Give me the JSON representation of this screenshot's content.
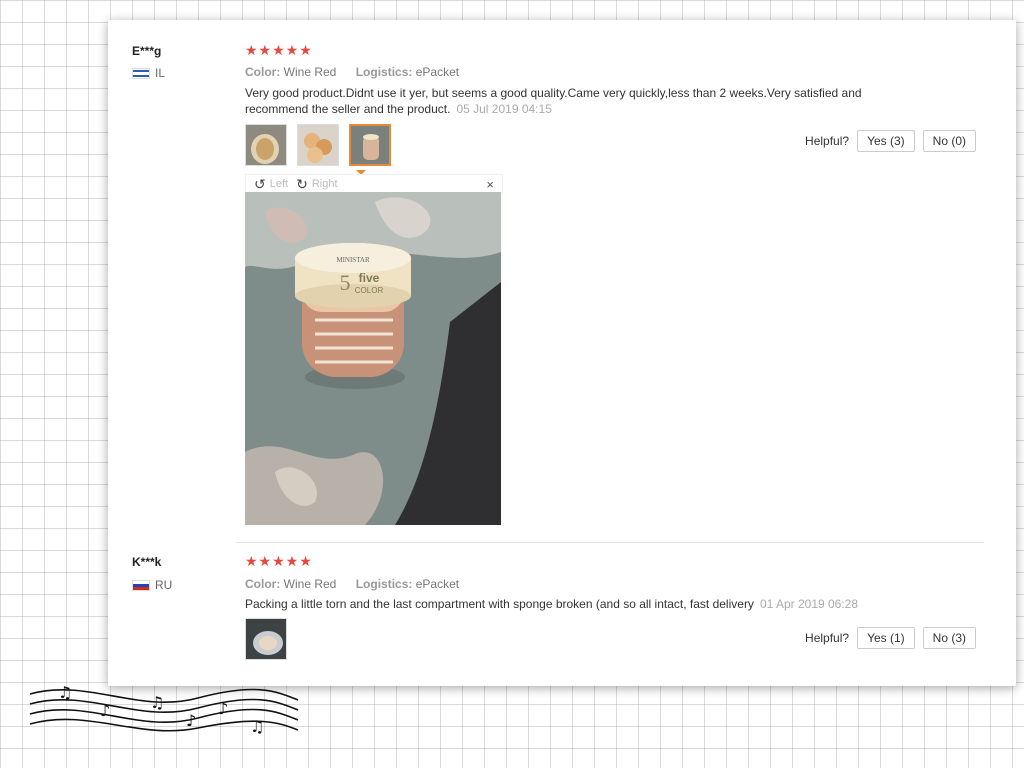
{
  "reviews": [
    {
      "user": "E***g",
      "country": "IL",
      "stars": "★★★★★",
      "color_label": "Color:",
      "color_value": "Wine Red",
      "logistics_label": "Logistics:",
      "logistics_value": "ePacket",
      "text": "Very good product.Didnt use it yer, but seems a good quality.Came very quickly,less than 2 weeks.Very satisfied and recommend the seller and the product.",
      "date": "05 Jul 2019 04:15",
      "helpful_label": "Helpful?",
      "yes_label": "Yes (3)",
      "no_label": "No (0)",
      "viewer": {
        "left_label": "Left",
        "right_label": "Right",
        "close": "×"
      }
    },
    {
      "user": "K***k",
      "country": "RU",
      "stars": "★★★★★",
      "color_label": "Color:",
      "color_value": "Wine Red",
      "logistics_label": "Logistics:",
      "logistics_value": "ePacket",
      "text": "Packing a little torn and the last compartment with sponge broken (and so all intact, fast delivery",
      "date": "01 Apr 2019 06:28",
      "helpful_label": "Helpful?",
      "yes_label": "Yes (1)",
      "no_label": "No (3)"
    }
  ],
  "product_label": {
    "line1": "MINISTAR",
    "line2": "5",
    "line3": "five",
    "line4": "COLOR"
  },
  "colors": {
    "star": "#e8473f",
    "accent_orange": "#e88a3c"
  }
}
